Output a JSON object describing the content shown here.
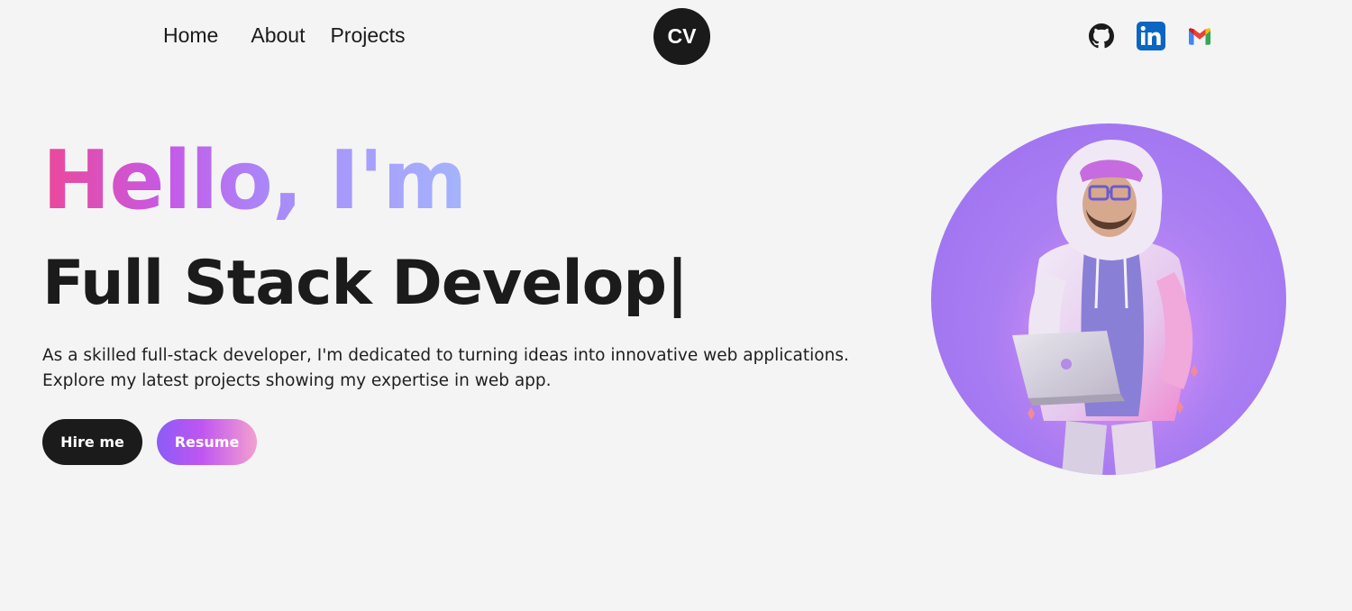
{
  "nav": {
    "links": [
      "Home",
      "About",
      "Projects"
    ]
  },
  "logo": {
    "text": "CV"
  },
  "socials": [
    {
      "name": "github-icon"
    },
    {
      "name": "linkedin-icon"
    },
    {
      "name": "gmail-icon"
    }
  ],
  "hero": {
    "greeting": "Hello, I'm",
    "role": "Full Stack Develop",
    "cursor": "|",
    "description": "As a skilled full-stack developer, I'm dedicated to turning ideas into innovative web applications. Explore my latest projects showing my expertise in web app.",
    "hire_label": "Hire me",
    "resume_label": "Resume"
  },
  "colors": {
    "background": "#f4f4f4",
    "dark": "#1b1b1b",
    "gradient_start": "#ec4899",
    "gradient_mid": "#a78bfa",
    "gradient_end": "#a5b4fc",
    "avatar_bg": "#a97ef2"
  }
}
